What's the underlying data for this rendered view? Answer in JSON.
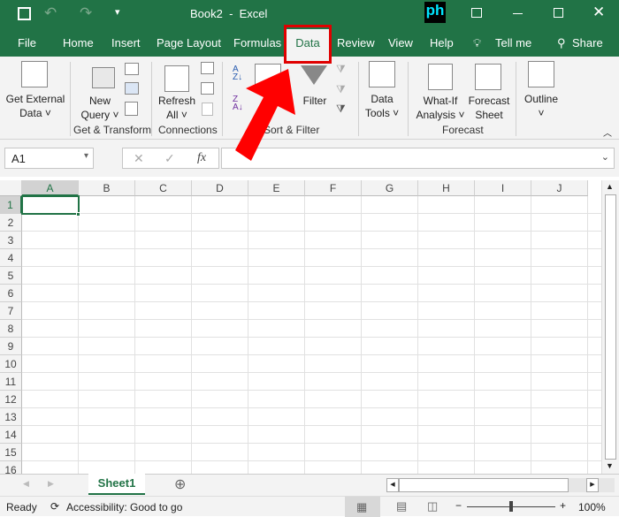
{
  "title_bar": {
    "title": "Book2  -  Excel",
    "logo_text": "ph",
    "icons": [
      "save-icon",
      "undo-icon",
      "redo-icon",
      "customize-icon",
      "ribbon-display-icon",
      "minimize-icon",
      "maximize-icon",
      "close-icon"
    ]
  },
  "tabs": [
    {
      "label": "File"
    },
    {
      "label": "Home"
    },
    {
      "label": "Insert"
    },
    {
      "label": "Page Layout"
    },
    {
      "label": "Formulas"
    },
    {
      "label": "Data",
      "active": true
    },
    {
      "label": "Review"
    },
    {
      "label": "View"
    },
    {
      "label": "Help"
    }
  ],
  "tell_me": "Tell me",
  "share": "Share",
  "ribbon": {
    "get_external_data": [
      "Get External",
      "Data ˅"
    ],
    "new_query": [
      "New",
      "Query ˅"
    ],
    "refresh_all": [
      "Refresh",
      "All ˅"
    ],
    "filter": "Filter",
    "data_tools": [
      "Data",
      "Tools ˅"
    ],
    "what_if": [
      "What-If",
      "Analysis ˅"
    ],
    "forecast_sheet": [
      "Forecast",
      "Sheet"
    ],
    "outline": "Outline",
    "groups": [
      "Get & Transform",
      "Connections",
      "Sort & Filter",
      "Forecast"
    ]
  },
  "formula_bar": {
    "name_box": "A1",
    "fx": "fx",
    "value": ""
  },
  "columns": [
    "A",
    "B",
    "C",
    "D",
    "E",
    "F",
    "G",
    "H",
    "I",
    "J"
  ],
  "rows": [
    "1",
    "2",
    "3",
    "4",
    "5",
    "6",
    "7",
    "8",
    "9",
    "10",
    "11",
    "12",
    "13",
    "14",
    "15",
    "16"
  ],
  "selected_cell": "A1",
  "sheet_tabs": [
    {
      "label": "Sheet1",
      "active": true
    }
  ],
  "status": {
    "ready": "Ready",
    "accessibility": "Accessibility: Good to go",
    "zoom": "100%",
    "zoom_percent": 100
  },
  "colors": {
    "brand": "#217346",
    "highlight": "#e00000"
  }
}
